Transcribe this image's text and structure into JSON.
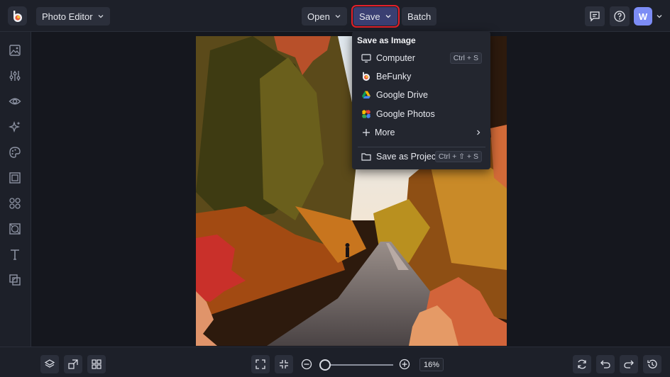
{
  "topbar": {
    "app_button_label": "Photo Editor",
    "open_label": "Open",
    "save_label": "Save",
    "batch_label": "Batch",
    "avatar_letter": "W"
  },
  "save_menu": {
    "title": "Save as Image",
    "items": [
      {
        "label": "Computer",
        "shortcut": "Ctrl + S",
        "icon": "monitor-icon"
      },
      {
        "label": "BeFunky",
        "shortcut": "",
        "icon": "befunky-logo-icon"
      },
      {
        "label": "Google Drive",
        "shortcut": "",
        "icon": "google-drive-icon"
      },
      {
        "label": "Google Photos",
        "shortcut": "",
        "icon": "google-photos-icon"
      },
      {
        "label": "More",
        "shortcut": "",
        "icon": "plus-icon"
      },
      {
        "label": "Save as Project",
        "shortcut": "Ctrl + ⇧ + S",
        "icon": "folder-icon"
      }
    ]
  },
  "sidebar": {
    "icons": [
      "image-icon",
      "sliders-icon",
      "eye-icon",
      "sparkle-icon",
      "palette-icon",
      "frame-icon",
      "shapes-icon",
      "texture-icon",
      "text-icon",
      "overlay-icon"
    ]
  },
  "bottombar": {
    "zoom_percent": "16%",
    "zoom_fraction": 0.02
  },
  "colors": {
    "accent": "#3a3f72",
    "highlight": "#e3202a",
    "panel": "#1d2029",
    "canvas": "#15171e"
  }
}
